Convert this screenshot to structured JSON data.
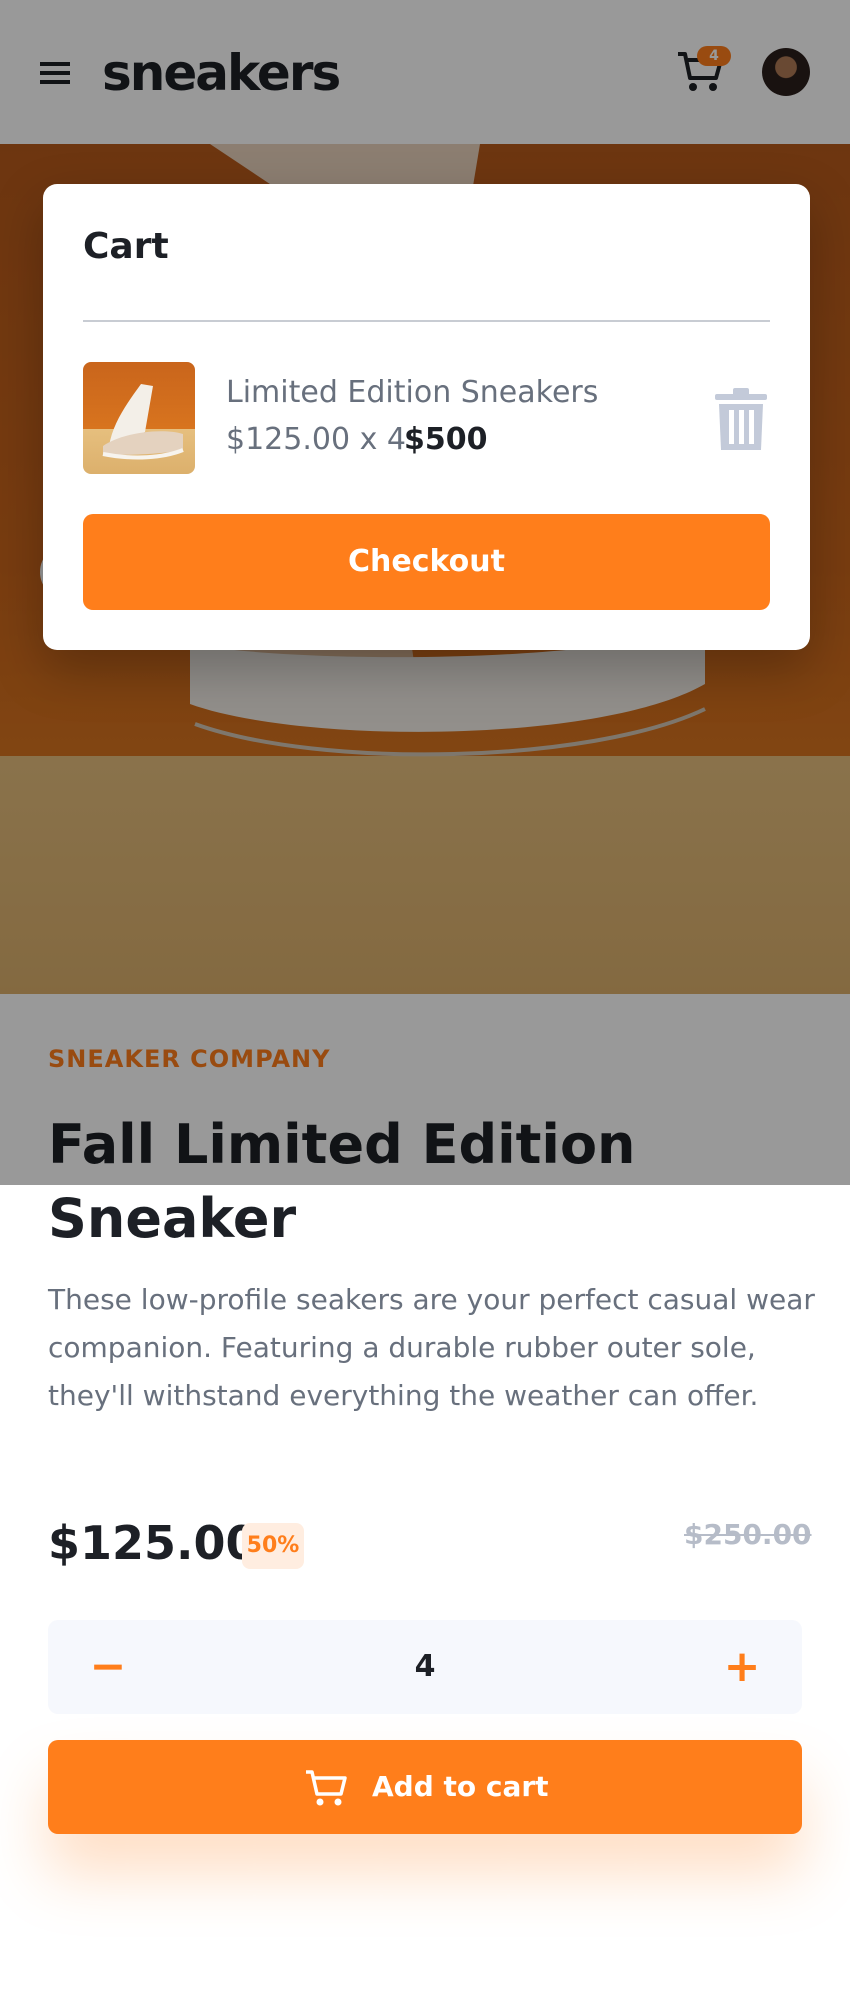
{
  "header": {
    "logo": "sneakers",
    "cart_count": "4",
    "menu_icon": "hamburger-menu-icon",
    "cart_icon": "cart-icon"
  },
  "cart": {
    "title": "Cart",
    "item": {
      "name": "Limited Edition Sneakers",
      "calc": "$125.00 x 4",
      "total": "$500"
    },
    "checkout_label": "Checkout"
  },
  "product": {
    "brand": "SNEAKER COMPANY",
    "title": "Fall Limited Edition Sneaker",
    "description": "These low-profile seakers are your perfect casual wear companion. Featuring a durable rubber outer sole, they'll withstand everything the weather can offer.",
    "price": "$125.00",
    "discount": "50%",
    "old_price": "$250.00",
    "quantity": "4",
    "minus_label": "−",
    "plus_label": "+",
    "add_to_cart_label": "Add to cart"
  },
  "colors": {
    "accent": "#ff7e1b",
    "text_dark": "#1d2026",
    "text_muted": "#68707d",
    "discount_bg": "#ffede0"
  }
}
